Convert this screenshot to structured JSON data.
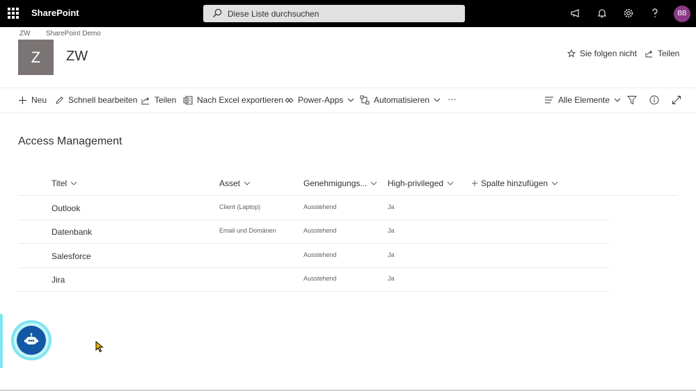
{
  "app": {
    "name": "SharePoint"
  },
  "search": {
    "placeholder": "Diese Liste durchsuchen"
  },
  "topbar_icons": [
    "megaphone-icon",
    "bell-icon",
    "gear-icon",
    "help-icon"
  ],
  "user": {
    "initials": "BB",
    "avatar_color": "#8a3a86"
  },
  "breadcrumb": [
    "ZW",
    "SharePoint Demo"
  ],
  "site": {
    "logo_letter": "Z",
    "title": "ZW",
    "logo_color": "#7a7574"
  },
  "header_actions": {
    "follow": "Sie folgen nicht",
    "share": "Teilen"
  },
  "commands": {
    "new": "Neu",
    "quick_edit": "Schnell bearbeiten",
    "share": "Teilen",
    "export_excel": "Nach Excel exportieren",
    "power_apps": "Power-Apps",
    "automate": "Automatisieren",
    "more": "···",
    "view": "Alle Elemente"
  },
  "list": {
    "title": "Access Management",
    "columns": [
      "Titel",
      "Asset",
      "Genehmigungs...",
      "High-privileged",
      "Spalte hinzufügen"
    ],
    "rows": [
      {
        "title": "Outlook",
        "asset": "Client (Laptop)",
        "approval": "Ausstehend",
        "privileged": "Ja"
      },
      {
        "title": "Datenbank",
        "asset": "Email und Domänen",
        "approval": "Ausstehend",
        "privileged": "Ja"
      },
      {
        "title": "Salesforce",
        "asset": "",
        "approval": "Ausstehend",
        "privileged": "Ja"
      },
      {
        "title": "Jira",
        "asset": "",
        "approval": "Ausstehend",
        "privileged": "Ja"
      }
    ]
  },
  "colors": {
    "topbar": "#000000",
    "bot": "#1358a5",
    "bot_halo": "#7fe5f0"
  }
}
